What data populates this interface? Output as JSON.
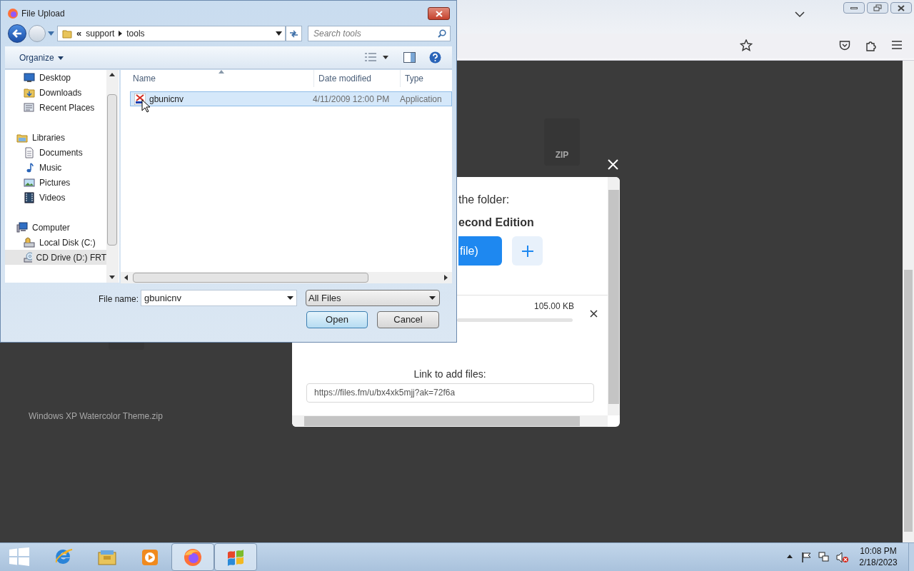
{
  "page": {
    "zip_label": "ZIP",
    "file_caption": "Windows XP Watercolor Theme.zip"
  },
  "modal": {
    "heading": "the folder:",
    "folder": "econd Edition",
    "upload_button": "file)",
    "file_size": "105.00 KB",
    "link_label": "Link to add files:",
    "link": "https://files.fm/u/bx4xk5mjj?ak=72f6a"
  },
  "dialog": {
    "title": "File Upload",
    "breadcrumb": [
      "«",
      "support",
      "tools"
    ],
    "search_placeholder": "Search tools",
    "organize": "Organize",
    "nav": [
      {
        "label": "Desktop",
        "kind": "desktop",
        "selected": false
      },
      {
        "label": "Downloads",
        "kind": "downloads",
        "selected": false
      },
      {
        "label": "Recent Places",
        "kind": "recent",
        "selected": false
      },
      {
        "label": "Libraries",
        "kind": "library",
        "selected": false,
        "children": [
          {
            "label": "Documents",
            "kind": "documents",
            "selected": false
          },
          {
            "label": "Music",
            "kind": "music",
            "selected": false
          },
          {
            "label": "Pictures",
            "kind": "pictures",
            "selected": false
          },
          {
            "label": "Videos",
            "kind": "videos",
            "selected": false
          }
        ]
      },
      {
        "label": "Computer",
        "kind": "computer",
        "selected": false,
        "children": [
          {
            "label": "Local Disk (C:)",
            "kind": "disk",
            "selected": false
          },
          {
            "label": "CD Drive (D:) FRT",
            "kind": "cd",
            "selected": true
          }
        ]
      }
    ],
    "columns": [
      "Name",
      "Date modified",
      "Type"
    ],
    "files": [
      {
        "name": "gbunicnv",
        "date": "4/11/2009 12:00 PM",
        "type": "Application",
        "selected": true
      }
    ],
    "file_name_label": "File name:",
    "file_name": "gbunicnv",
    "filter": "All Files",
    "buttons": [
      "Open",
      "Cancel"
    ]
  },
  "taskbar": {
    "apps": [
      {
        "kind": "ie",
        "selected": false
      },
      {
        "kind": "explorer",
        "selected": false
      },
      {
        "kind": "media",
        "selected": false
      },
      {
        "kind": "firefox",
        "selected": true
      },
      {
        "kind": "windows",
        "selected": true
      }
    ],
    "time": "10:08 PM",
    "date": "2/18/2023"
  }
}
